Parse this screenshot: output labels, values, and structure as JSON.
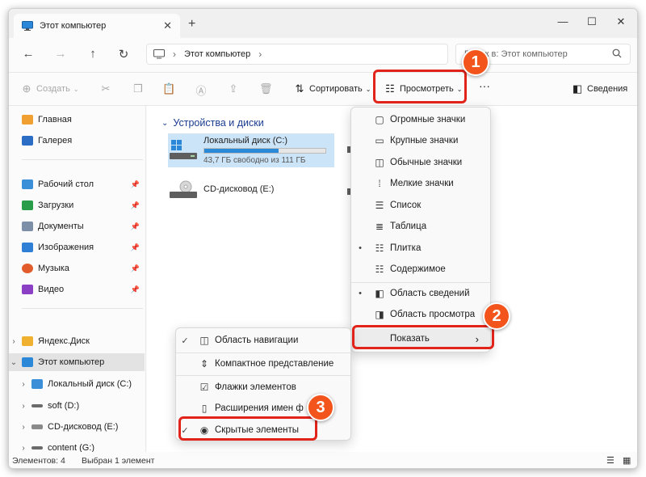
{
  "window": {
    "tab_title": "Этот компьютер",
    "tab_close": "✕",
    "new_tab": "+",
    "minimize": "—",
    "maximize": "☐",
    "close": "✕"
  },
  "nav": {
    "back": "←",
    "forward": "→",
    "up": "↑",
    "refresh": "↻",
    "address_segment": "Этот компьютер",
    "address_chevron": "›",
    "search_placeholder": "Поиск в: Этот компьютер"
  },
  "toolbar": {
    "create": "Создать",
    "sort": "Сортировать",
    "view": "Просмотреть",
    "more": "···",
    "details": "Сведения"
  },
  "sidebar": {
    "quick": [
      {
        "label": "Главная",
        "icon": "home-icon",
        "pinned": false
      },
      {
        "label": "Галерея",
        "icon": "gallery-icon",
        "pinned": false
      },
      {
        "label": "Рабочий стол",
        "icon": "desktop-icon",
        "pinned": true
      },
      {
        "label": "Загрузки",
        "icon": "download-icon",
        "pinned": true
      },
      {
        "label": "Документы",
        "icon": "documents-icon",
        "pinned": true
      },
      {
        "label": "Изображения",
        "icon": "pictures-icon",
        "pinned": true
      },
      {
        "label": "Музыка",
        "icon": "music-icon",
        "pinned": true
      },
      {
        "label": "Видео",
        "icon": "video-icon",
        "pinned": true
      }
    ],
    "tree": [
      {
        "label": "Яндекс.Диск",
        "icon": "yandex-disk-icon",
        "selected": false
      },
      {
        "label": "Этот компьютер",
        "icon": "computer-icon",
        "selected": true
      },
      {
        "label": "Локальный диск (C:)",
        "icon": "windows-drive-icon",
        "selected": false
      },
      {
        "label": "soft (D:)",
        "icon": "drive-icon",
        "selected": false
      },
      {
        "label": "CD-дисковод (E:)",
        "icon": "cd-drive-icon",
        "selected": false
      },
      {
        "label": "content (G:)",
        "icon": "drive-icon",
        "selected": false
      }
    ]
  },
  "content": {
    "group_header": "Устройства и диски",
    "drives": [
      {
        "name": "Локальный диск (C:)",
        "free": "43,7 ГБ свободно из 111 ГБ",
        "used_fraction": 0.61
      },
      {
        "name": "CD-дисковод (E:)"
      }
    ]
  },
  "view_menu": {
    "items": [
      {
        "label": "Огромные значки",
        "icon": "huge-icons-icon",
        "checked": false
      },
      {
        "label": "Крупные значки",
        "icon": "large-icons-icon",
        "checked": false
      },
      {
        "label": "Обычные значки",
        "icon": "medium-icons-icon",
        "checked": false
      },
      {
        "label": "Мелкие значки",
        "icon": "small-icons-icon",
        "checked": false
      },
      {
        "label": "Список",
        "icon": "list-icon",
        "checked": false
      },
      {
        "label": "Таблица",
        "icon": "details-icon",
        "checked": false
      },
      {
        "label": "Плитка",
        "icon": "tiles-icon",
        "checked": true
      },
      {
        "label": "Содержимое",
        "icon": "content-icon",
        "checked": false
      }
    ],
    "panes": [
      {
        "label": "Область сведений",
        "checked": true
      },
      {
        "label": "Область просмотра",
        "checked": false
      }
    ],
    "show": "Показать",
    "show_chevron": "›"
  },
  "show_menu": {
    "items": [
      {
        "label": "Область навигации",
        "checked": true
      },
      {
        "label": "Компактное представление",
        "checked": false
      },
      {
        "label": "Флажки элементов",
        "checked": false
      },
      {
        "label": "Расширения имен ф",
        "checked": false
      },
      {
        "label": "Скрытые элементы",
        "checked": true
      }
    ]
  },
  "callouts": [
    "1",
    "2",
    "3"
  ],
  "status": {
    "count": "Элементов: 4",
    "selected": "Выбран 1 элемент"
  },
  "colors": {
    "accent": "#0067c0",
    "highlight": "#e2231a",
    "callout": "#f2541b",
    "selection": "#cce4f7"
  }
}
